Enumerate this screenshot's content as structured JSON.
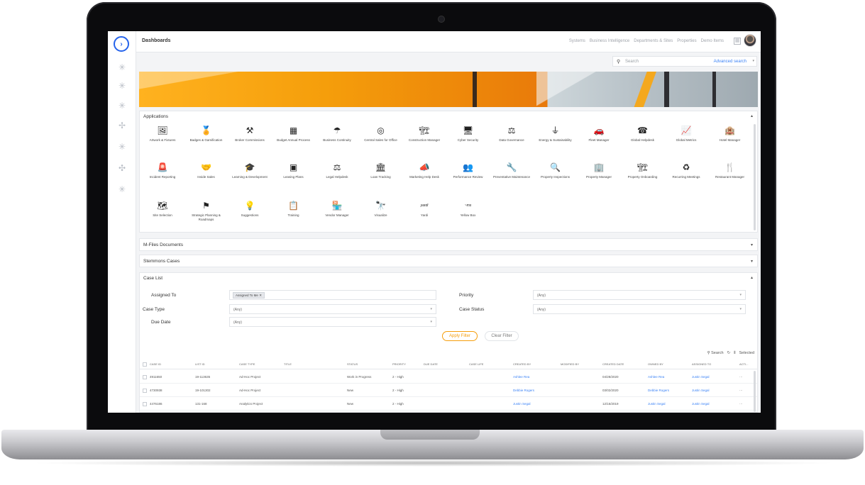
{
  "topbar": {
    "title": "Dashboards",
    "nav": [
      "Systems",
      "Business Intelligence",
      "Departments & Sites",
      "Properties",
      "Demo Items"
    ]
  },
  "search": {
    "placeholder": "Search",
    "advanced_label": "Advanced search"
  },
  "rail": {
    "icons": [
      "logo-icon",
      "sparkle-icon",
      "sparkle-icon",
      "sparkle-icon",
      "sparkle-icon",
      "sparkle-icon",
      "sparkle-icon",
      "sparkle-icon"
    ]
  },
  "applications": {
    "title": "Applications",
    "rows": [
      [
        {
          "label": "Artwork & Fixtures",
          "icon": "🖼"
        },
        {
          "label": "Badges & Gamification",
          "icon": "🏅"
        },
        {
          "label": "Broker Commissions",
          "icon": "⚒"
        },
        {
          "label": "Budget Annual Process",
          "icon": "▦"
        },
        {
          "label": "Business Continuity",
          "icon": "☂"
        },
        {
          "label": "Central Sales for Office",
          "icon": "◎"
        },
        {
          "label": "Construction Manager",
          "icon": "🏗"
        },
        {
          "label": "Cyber Security",
          "icon": "🖥"
        },
        {
          "label": "Data Governance",
          "icon": "⚖"
        },
        {
          "label": "Energy & Sustainability",
          "icon": "⏚"
        },
        {
          "label": "Fleet Manager",
          "icon": "🚗"
        },
        {
          "label": "Global Helpdesk",
          "icon": "☎"
        },
        {
          "label": "Global Metrics",
          "icon": "📈"
        },
        {
          "label": "Hotel Manager",
          "icon": "🏨"
        }
      ],
      [
        {
          "label": "Incident Reporting",
          "icon": "🚨"
        },
        {
          "label": "Inside Sales",
          "icon": "🤝"
        },
        {
          "label": "Learning & Development",
          "icon": "🎓"
        },
        {
          "label": "Leasing Plans",
          "icon": "▣"
        },
        {
          "label": "Legal Helpdesk",
          "icon": "⚖"
        },
        {
          "label": "Loan Tracking",
          "icon": "🏛"
        },
        {
          "label": "Marketing Help Desk",
          "icon": "📣"
        },
        {
          "label": "Performance Review",
          "icon": "👥"
        },
        {
          "label": "Preventative Maintenance",
          "icon": "🔧"
        },
        {
          "label": "Property Inspections",
          "icon": "🔍"
        },
        {
          "label": "Property Manager",
          "icon": "🏢"
        },
        {
          "label": "Property Onboarding",
          "icon": "🏗"
        },
        {
          "label": "Recurring Meetings",
          "icon": "♻"
        },
        {
          "label": "Restaurant Manager",
          "icon": "🍴"
        }
      ],
      [
        {
          "label": "Site Selection",
          "icon": "🗺"
        },
        {
          "label": "Strategic Planning & Roadmaps",
          "icon": "⚑"
        },
        {
          "label": "Suggestions",
          "icon": "💡"
        },
        {
          "label": "Training",
          "icon": "📋"
        },
        {
          "label": "Vendor Manager",
          "icon": "🏪"
        },
        {
          "label": "Visualize",
          "icon": "🔭"
        },
        {
          "label": "Yardi",
          "icon": "yardi"
        },
        {
          "label": "Yellow Box",
          "icon": "~ms"
        }
      ]
    ]
  },
  "panels": {
    "mfiles": "M-Files Documents",
    "stemmons": "Stemmons Cases",
    "caselist": "Case List"
  },
  "filters": {
    "assigned_to_label": "Assigned To",
    "assigned_to_tag": "Assigned To Me",
    "priority_label": "Priority",
    "priority_value": "(Any)",
    "case_type_label": "Case Type",
    "case_type_value": "(Any)",
    "case_status_label": "Case Status",
    "case_status_value": "(Any)",
    "due_date_label": "Due Date",
    "due_date_value": "(Any)",
    "apply_label": "Apply Filter",
    "clear_label": "Clear Filter"
  },
  "table_tools": {
    "search": "Search",
    "selected": "Selected"
  },
  "table": {
    "columns": [
      "CASE ID",
      "LIST ID",
      "CASE TYPE",
      "TITLE",
      "STATUS",
      "PRIORITY",
      "DUE DATE",
      "CASE LIFE",
      "CREATED BY",
      "MODIFIED BY",
      "CREATED DATE",
      "OWNED BY",
      "ASSIGNED TO",
      "ACTI..."
    ],
    "rows": [
      [
        "4911650",
        "19-113635",
        "Ad-Hoc Project",
        "",
        "Work in Progress",
        "2 - High",
        "",
        "",
        "Ashlee Rea",
        "",
        "04/28/2020",
        "Ashlee Rea",
        "Justin Segal",
        "···"
      ],
      [
        "4730938",
        "19-101302",
        "Ad-Hoc Project",
        "",
        "New",
        "2 - High",
        "",
        "",
        "Debbie Rogers",
        "",
        "03/02/2020",
        "Debbie Rogers",
        "Justin Segal",
        "···"
      ],
      [
        "4476186",
        "131-168",
        "Analytics Project",
        "",
        "New",
        "2 - High",
        "",
        "",
        "Justin Segal",
        "",
        "12/16/2019",
        "Justin Segal",
        "Justin Segal",
        "···"
      ]
    ]
  },
  "colors": {
    "accent": "#3b82f6",
    "apply": "#f59e0b"
  }
}
